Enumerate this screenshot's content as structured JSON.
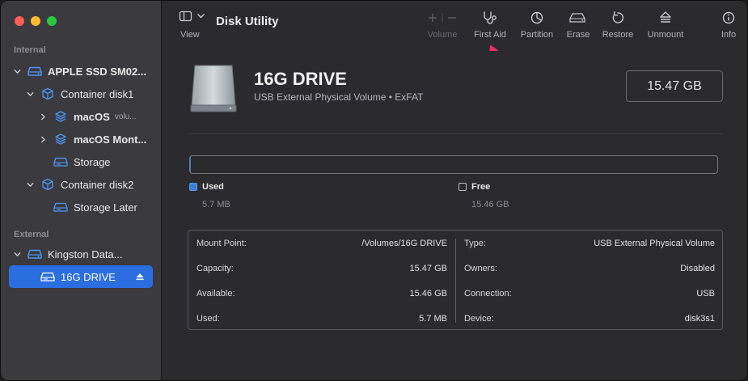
{
  "window": {
    "title": "Disk Utility"
  },
  "toolbar": {
    "view_label": "View",
    "volume_label": "Volume",
    "first_aid_label": "First Aid",
    "partition_label": "Partition",
    "erase_label": "Erase",
    "restore_label": "Restore",
    "unmount_label": "Unmount",
    "info_label": "Info"
  },
  "sidebar": {
    "internal_label": "Internal",
    "external_label": "External",
    "items": [
      {
        "label": "APPLE SSD SM02..."
      },
      {
        "label": "Container disk1"
      },
      {
        "label": "macOS",
        "sub": "volu..."
      },
      {
        "label": "macOS Mont..."
      },
      {
        "label": "Storage"
      },
      {
        "label": "Container disk2"
      },
      {
        "label": "Storage Later"
      },
      {
        "label": "Kingston Data..."
      },
      {
        "label": "16G DRIVE"
      }
    ]
  },
  "drive": {
    "name": "16G DRIVE",
    "description": "USB External Physical Volume • ExFAT",
    "size": "15.47 GB"
  },
  "usage": {
    "used_label": "Used",
    "used_value": "5.7 MB",
    "free_label": "Free",
    "free_value": "15.46 GB",
    "used_fraction": 0.0004
  },
  "info": {
    "left": [
      {
        "key": "Mount Point:",
        "value": "/Volumes/16G DRIVE"
      },
      {
        "key": "Capacity:",
        "value": "15.47 GB"
      },
      {
        "key": "Available:",
        "value": "15.46 GB"
      },
      {
        "key": "Used:",
        "value": "5.7 MB"
      }
    ],
    "right": [
      {
        "key": "Type:",
        "value": "USB External Physical Volume"
      },
      {
        "key": "Owners:",
        "value": "Disabled"
      },
      {
        "key": "Connection:",
        "value": "USB"
      },
      {
        "key": "Device:",
        "value": "disk3s1"
      }
    ]
  },
  "colors": {
    "accent": "#2b6ee0",
    "used_swatch": "#3a80d9",
    "annotation_arrow": "#f5306e"
  }
}
